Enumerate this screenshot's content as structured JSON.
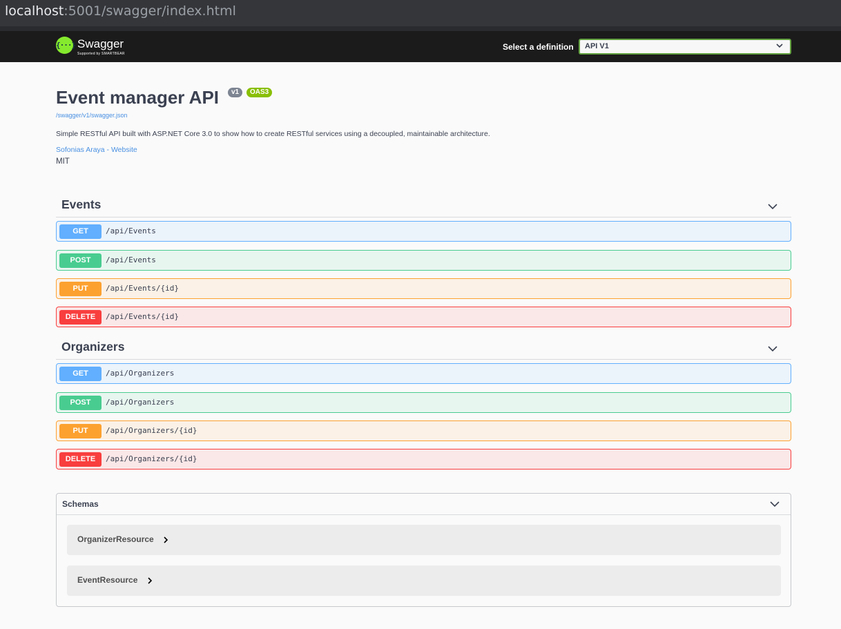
{
  "browser": {
    "url_host": "localhost",
    "url_rest": ":5001/swagger/index.html"
  },
  "topbar": {
    "logo_mark": "{···}",
    "logo_name": "Swagger",
    "logo_sub": "Supported by SMARTBEAR",
    "definition_label": "Select a definition",
    "definition_value": "API V1"
  },
  "info": {
    "title": "Event manager API",
    "version_badge": "v1",
    "oas_badge": "OAS3",
    "spec_link": "/swagger/v1/swagger.json",
    "description": "Simple RESTful API built with ASP.NET Core 3.0 to show how to create RESTful services using a decoupled, maintainable architecture.",
    "contact": "Sofonias Araya - Website",
    "license": "MIT"
  },
  "tags": [
    {
      "name": "Events",
      "operations": [
        {
          "method": "GET",
          "path": "/api/Events"
        },
        {
          "method": "POST",
          "path": "/api/Events"
        },
        {
          "method": "PUT",
          "path": "/api/Events/{id}"
        },
        {
          "method": "DELETE",
          "path": "/api/Events/{id}"
        }
      ]
    },
    {
      "name": "Organizers",
      "operations": [
        {
          "method": "GET",
          "path": "/api/Organizers"
        },
        {
          "method": "POST",
          "path": "/api/Organizers"
        },
        {
          "method": "PUT",
          "path": "/api/Organizers/{id}"
        },
        {
          "method": "DELETE",
          "path": "/api/Organizers/{id}"
        }
      ]
    }
  ],
  "schemas": {
    "label": "Schemas",
    "models": [
      {
        "name": "OrganizerResource"
      },
      {
        "name": "EventResource"
      }
    ]
  },
  "icons": {
    "collapse": "chevron-down-icon",
    "expand_model": "chevron-right-icon",
    "select": "chevron-down-icon"
  },
  "colors": {
    "get": "#61affe",
    "post": "#49cc90",
    "put": "#fca130",
    "delete": "#f93e3e",
    "brand": "#85ea2d",
    "topbar": "#1b1b1b"
  }
}
